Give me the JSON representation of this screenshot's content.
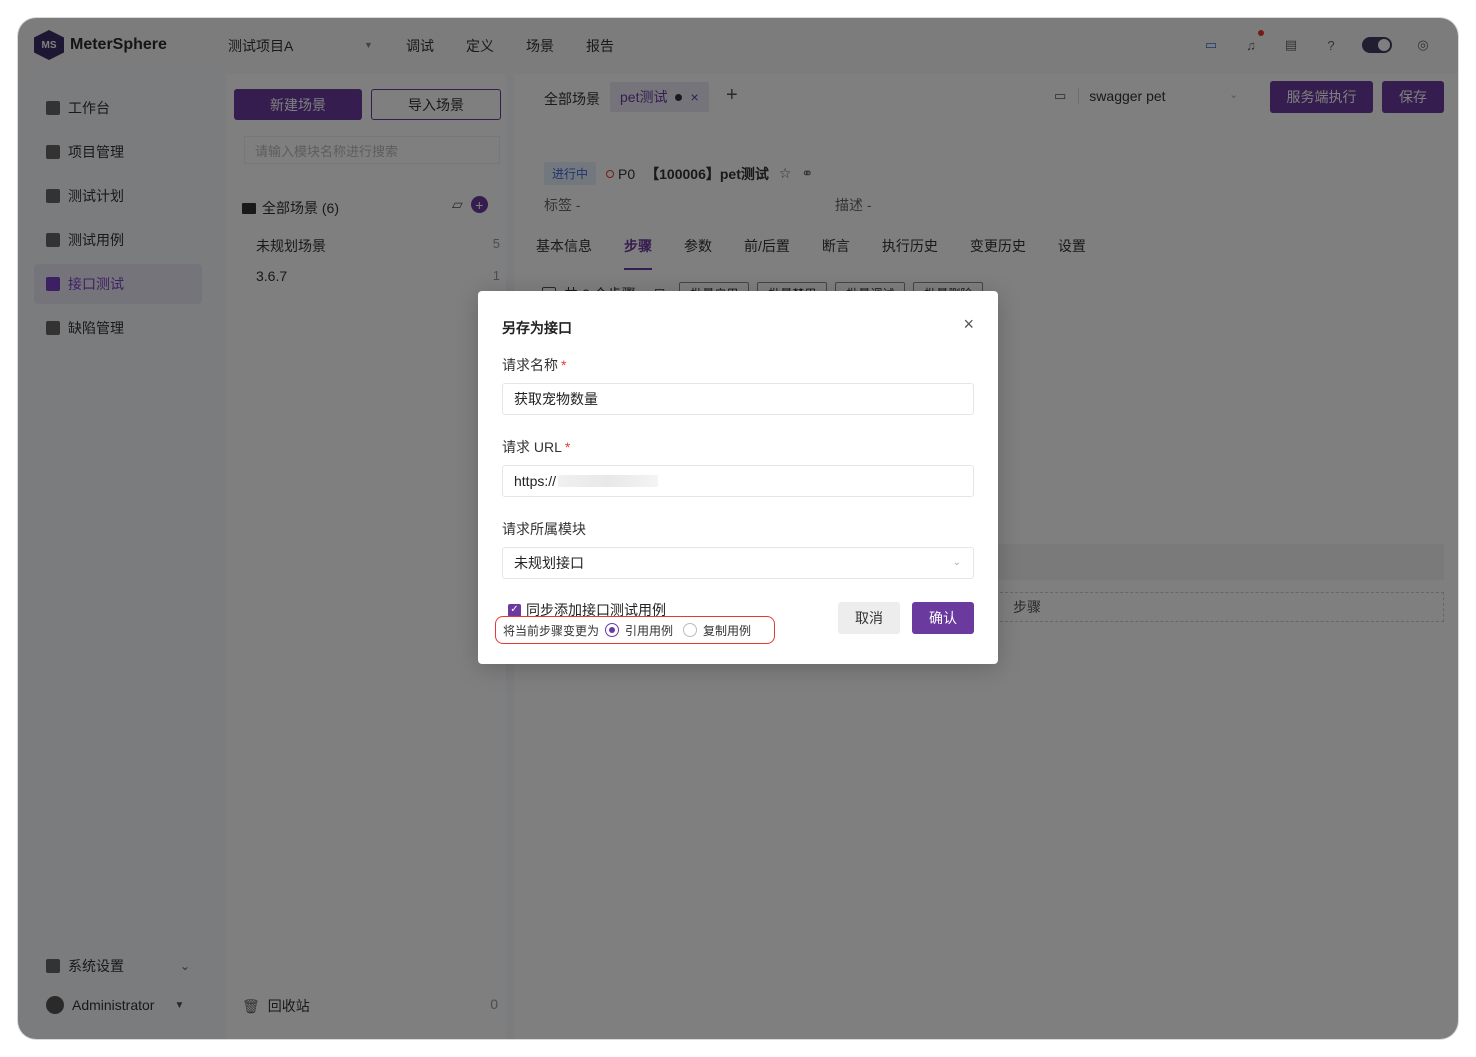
{
  "app": {
    "logo_text": "MeterSphere",
    "logo_mark": "MS",
    "project": "测试项目A",
    "topnav": [
      "调试",
      "定义",
      "场景",
      "报告"
    ],
    "top_icons": [
      "chat-icon",
      "bell-icon",
      "task-icon",
      "help-icon",
      "theme-toggle",
      "user-circle-icon"
    ]
  },
  "sidebar": {
    "items": [
      {
        "label": "工作台",
        "icon": "dashboard-icon"
      },
      {
        "label": "项目管理",
        "icon": "project-icon"
      },
      {
        "label": "测试计划",
        "icon": "plan-icon"
      },
      {
        "label": "测试用例",
        "icon": "case-icon"
      },
      {
        "label": "接口测试",
        "icon": "api-icon",
        "active": true
      },
      {
        "label": "缺陷管理",
        "icon": "bug-icon"
      }
    ],
    "settings": "系统设置",
    "user": "Administrator"
  },
  "tree": {
    "new_button": "新建场景",
    "import_button": "导入场景",
    "search_placeholder": "请输入模块名称进行搜索",
    "root_label": "全部场景 (6)",
    "rows": [
      {
        "label": "未规划场景",
        "count": "5"
      },
      {
        "label": "3.6.7",
        "count": "1"
      }
    ],
    "recycle_label": "回收站",
    "recycle_count": "0"
  },
  "main": {
    "tab_all": "全部场景",
    "tab_current": "pet测试",
    "env_value": "swagger pet",
    "server_exec_button": "服务端执行",
    "save_button": "保存",
    "status": "进行中",
    "priority": "P0",
    "title": "【100006】pet测试",
    "tag_label": "标签",
    "tag_value": "-",
    "desc_label": "描述",
    "desc_value": "-",
    "detail_tabs": [
      "基本信息",
      "步骤",
      "参数",
      "前/后置",
      "断言",
      "执行历史",
      "变更历史",
      "设置"
    ],
    "steps_count": "共 6 个步骤",
    "batch_buttons": [
      "批量启用",
      "批量禁用",
      "批量调试",
      "批量删除"
    ],
    "add_step_partial": "步骤"
  },
  "modal": {
    "title": "另存为接口",
    "name_label": "请求名称",
    "name_value": "获取宠物数量",
    "url_label": "请求 URL",
    "url_value": "https://",
    "module_label": "请求所属模块",
    "module_value": "未规划接口",
    "sync_checkbox_label": "同步添加接口测试用例",
    "sync_checked": true,
    "change_step_label": "将当前步骤变更为",
    "radio_options": [
      "引用用例",
      "复制用例"
    ],
    "radio_selected": "引用用例",
    "cancel_button": "取消",
    "confirm_button": "确认"
  }
}
